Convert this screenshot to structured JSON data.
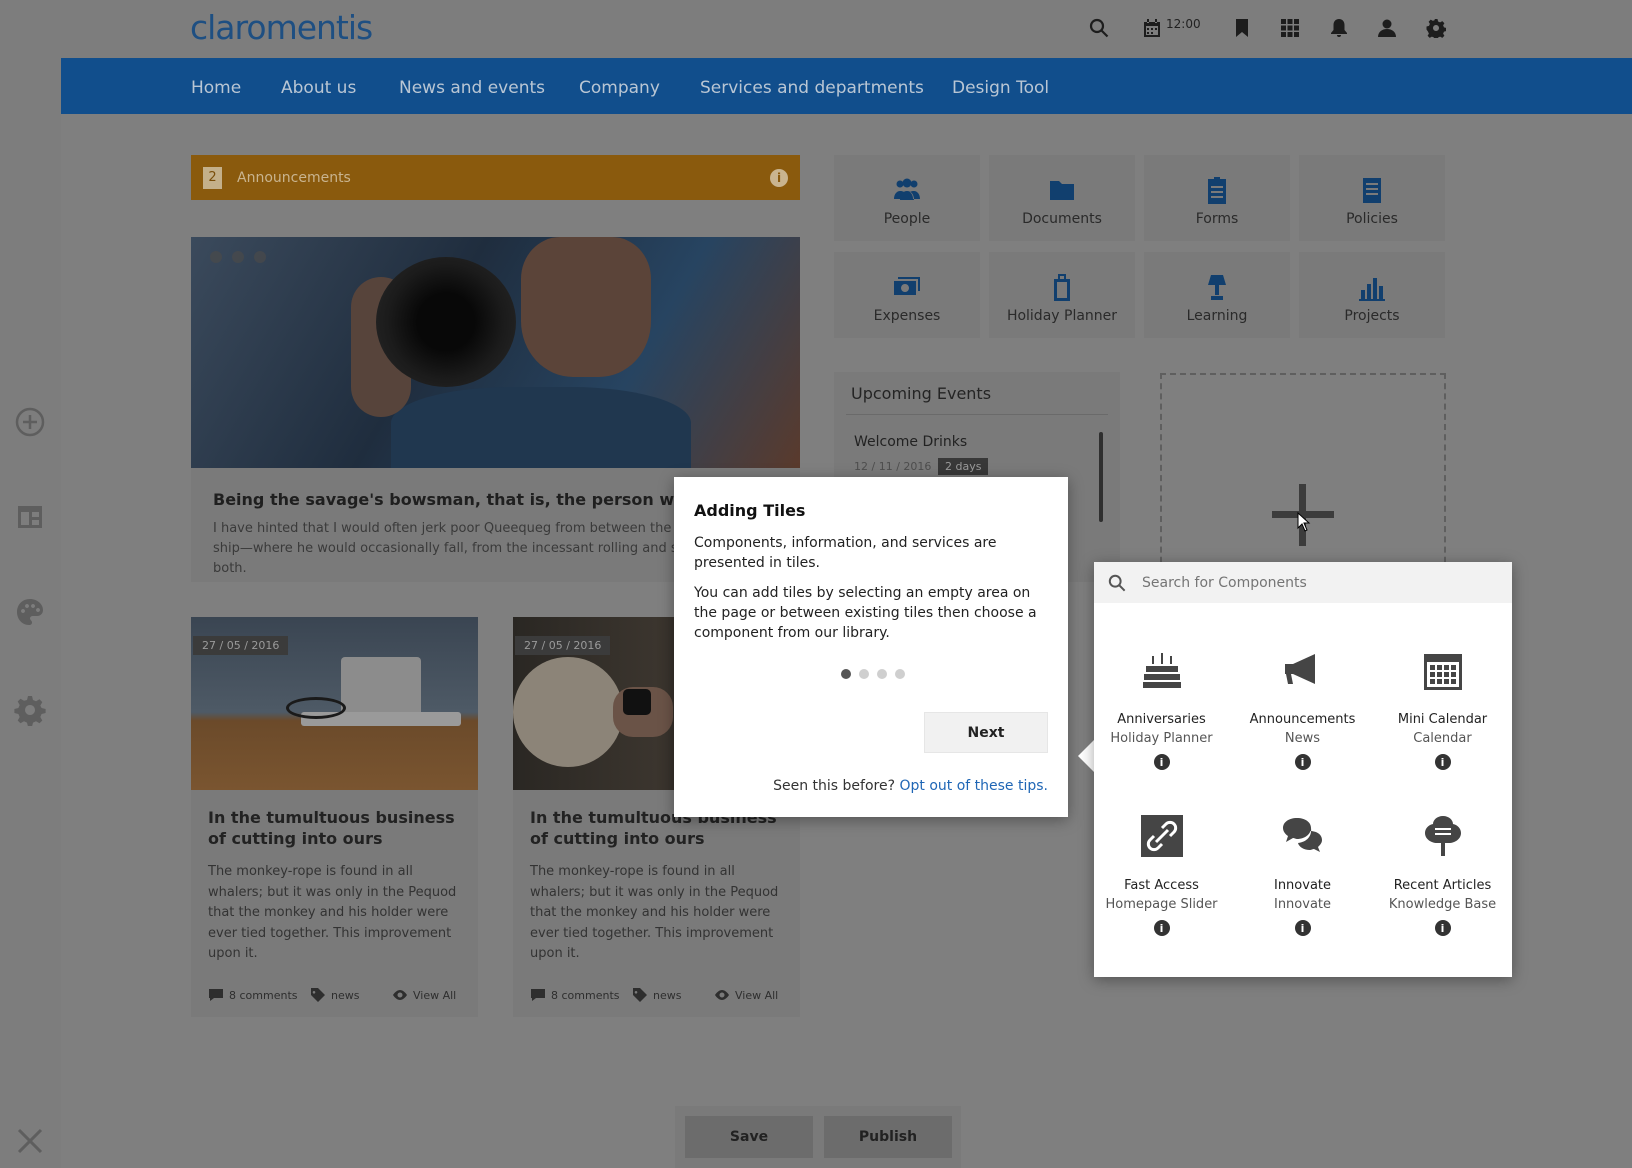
{
  "brand": {
    "logo_text": "claromentis",
    "accent": "#114e8c"
  },
  "topbar": {
    "time": "12:00",
    "icons": [
      "search-icon",
      "calendar-icon",
      "bookmark-icon",
      "apps-grid-icon",
      "bell-icon",
      "user-icon",
      "gear-icon"
    ]
  },
  "nav": {
    "items": [
      {
        "label": "Home"
      },
      {
        "label": "About us"
      },
      {
        "label": "News and events"
      },
      {
        "label": "Company"
      },
      {
        "label": "Services and departments"
      },
      {
        "label": "Design Tool"
      }
    ]
  },
  "rail": {
    "icons": [
      "add-circle-icon",
      "layout-icon",
      "palette-icon",
      "gear-icon",
      "close-icon"
    ]
  },
  "announcements": {
    "count": "2",
    "label": "Announcements",
    "info": "i"
  },
  "hero": {
    "title": "Being the savage's bowsman, that is, the person who pulled",
    "text": "I have hinted that I would often jerk poor Queequeg from between the whale and the ship—where he would occasionally fall, from the incessant rolling and swaying of both."
  },
  "cards": [
    {
      "date": "27 / 05 / 2016",
      "title": "In the tumultuous business of cutting into ours",
      "text": "The monkey-rope is found in all whalers; but it was only in the Pequod that the monkey and his holder were ever tied together. This improvement upon it.",
      "comments": "8 comments",
      "tag": "news",
      "view": "View All"
    },
    {
      "date": "27 / 05 / 2016",
      "title": "In the tumultuous business of cutting into ours",
      "text": "The monkey-rope is found in all whalers; but it was only in the Pequod that the monkey and his holder were ever tied together. This improvement upon it.",
      "comments": "8 comments",
      "tag": "news",
      "view": "View All"
    }
  ],
  "tiles": [
    {
      "label": "People",
      "icon": "people-icon"
    },
    {
      "label": "Documents",
      "icon": "folder-icon"
    },
    {
      "label": "Forms",
      "icon": "clipboard-icon"
    },
    {
      "label": "Policies",
      "icon": "document-icon"
    },
    {
      "label": "Expenses",
      "icon": "money-icon"
    },
    {
      "label": "Holiday Planner",
      "icon": "luggage-icon"
    },
    {
      "label": "Learning",
      "icon": "lamp-icon"
    },
    {
      "label": "Projects",
      "icon": "bar-chart-icon"
    }
  ],
  "events": {
    "title": "Upcoming Events",
    "items": [
      {
        "name": "Welcome Drinks",
        "date": "12 / 11 / 2016",
        "badge": "2 days"
      }
    ]
  },
  "tip": {
    "title": "Adding Tiles",
    "p1": "Components, information, and services are presented in tiles.",
    "p2": "You can add tiles by selecting an empty area on the page or between existing tiles then choose a component from our library.",
    "next": "Next",
    "foot_text": "Seen this before?",
    "foot_link": "Opt out of these tips.",
    "step": 1,
    "steps": 4
  },
  "components": {
    "search_placeholder": "Search for Components",
    "items": [
      {
        "name": "Anniversaries",
        "sub": "Holiday Planner",
        "icon": "cake-icon"
      },
      {
        "name": "Announcements",
        "sub": "News",
        "icon": "megaphone-icon"
      },
      {
        "name": "Mini Calendar",
        "sub": "Calendar",
        "icon": "calendar-grid-icon"
      },
      {
        "name": "Fast Access",
        "sub": "Homepage Slider",
        "icon": "link-icon"
      },
      {
        "name": "Innovate",
        "sub": "Innovate",
        "icon": "chat-bubbles-icon"
      },
      {
        "name": "Recent Articles",
        "sub": "Knowledge Base",
        "icon": "tree-icon"
      }
    ]
  },
  "actions": {
    "save": "Save",
    "publish": "Publish"
  }
}
